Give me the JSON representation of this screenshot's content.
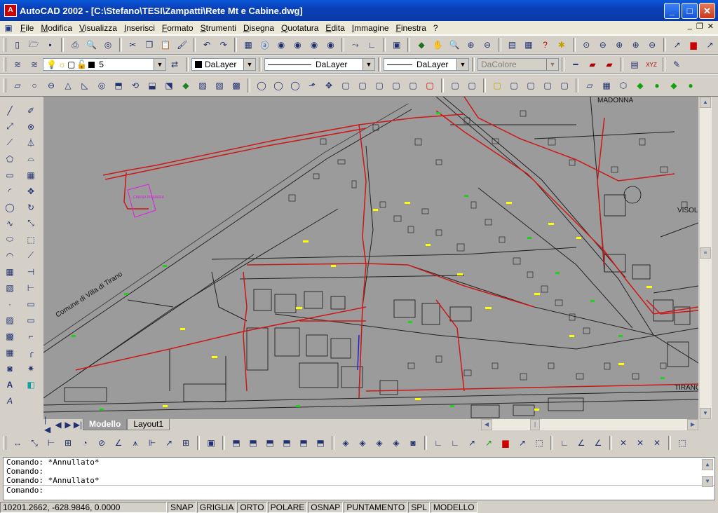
{
  "window": {
    "title": "AutoCAD 2002 - [C:\\Stefano\\TESI\\Zampatti\\Rete Mt e Cabine.dwg]"
  },
  "menu": [
    "File",
    "Modifica",
    "Visualizza",
    "Inserisci",
    "Formato",
    "Strumenti",
    "Disegna",
    "Quotatura",
    "Edita",
    "Immagine",
    "Finestra",
    "?"
  ],
  "layers": {
    "current_layer": "5",
    "color": "DaLayer",
    "linetype": "DaLayer",
    "lineweight": "DaLayer",
    "plotstyle": "DaColore"
  },
  "drawing": {
    "labels": {
      "madonna": "MADONNA",
      "villa_di_tirano": "Comune  di  Villa  di  Tirano",
      "tirano": "TIRANO",
      "visol": "VISOL",
      "cabina": "CABINA PRIMARIA"
    }
  },
  "tabs": {
    "model": "Modello",
    "layout1": "Layout1"
  },
  "command": {
    "lines": [
      "Comando: *Annullato*",
      "Comando:",
      "Comando: *Annullato*",
      "Comando:"
    ]
  },
  "status": {
    "coords": "10201.2662, -628.9846, 0.0000",
    "toggles": [
      "SNAP",
      "GRIGLIA",
      "ORTO",
      "POLARE",
      "OSNAP",
      "PUNTAMENTO",
      "SPL",
      "MODELLO"
    ]
  },
  "colors": {
    "title": "#0a4bd0",
    "canvas": "#9b9b9b",
    "network": "#cc1818",
    "highlight": "#ffff00"
  }
}
